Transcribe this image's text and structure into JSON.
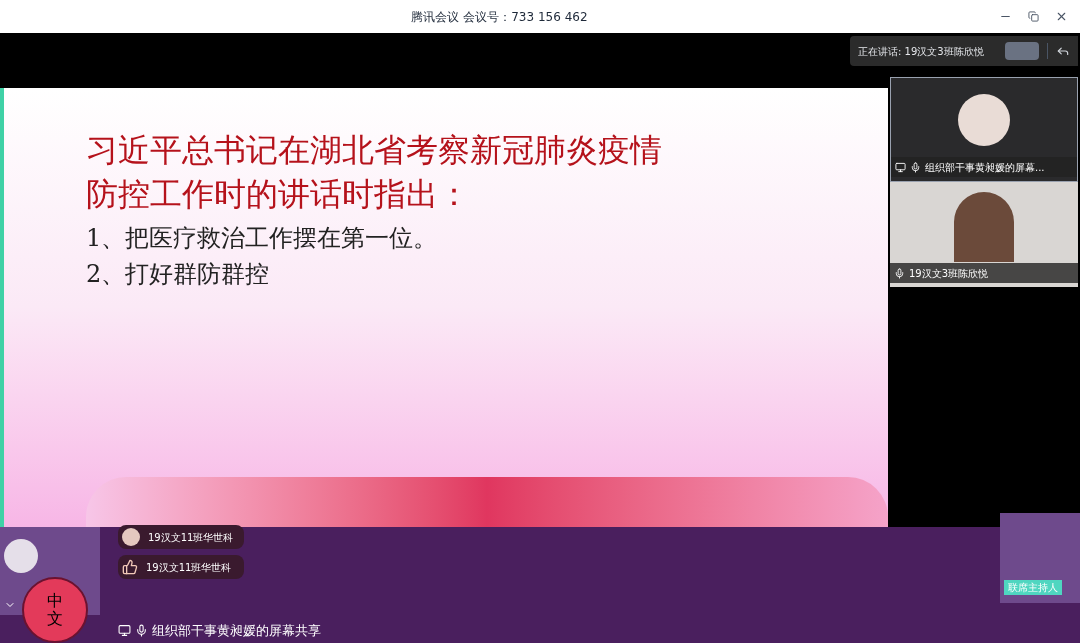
{
  "window": {
    "title": "腾讯会议 会议号：733 156 462"
  },
  "speaker": {
    "label": "正在讲话: 19汉文3班陈欣悦"
  },
  "slide": {
    "heading_lines": [
      "习近平总书记在湖北省考察新冠肺炎疫情",
      "防控工作时的讲话时指出："
    ],
    "points": [
      "1、把医疗救治工作摆在第一位。",
      "2、打好群防群控"
    ],
    "logo": "中文"
  },
  "videos": [
    {
      "name": "组织部干事黄昶媛的屏幕...",
      "sharing": true,
      "kind": "avatar"
    },
    {
      "name": "19汉文3班陈欣悦",
      "sharing": false,
      "kind": "camera"
    }
  ],
  "reactions": [
    {
      "name": "19汉文11班华世科",
      "kind": "avatar"
    },
    {
      "name": "19汉文11班华世科",
      "kind": "thumbs"
    }
  ],
  "share_label": "组织部干事黄昶媛的屏幕共享",
  "cohost": {
    "badge": "联席主持人"
  }
}
